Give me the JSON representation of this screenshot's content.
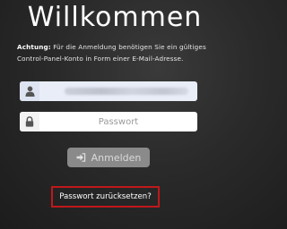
{
  "heading": "Willkommen",
  "notice": {
    "label": "Achtung:",
    "text": "Für die Anmeldung benötigen Sie ein gültiges Control-Panel-Konto in Form einer E-Mail-Adresse."
  },
  "form": {
    "username_icon": "user-icon",
    "password_icon": "lock-icon",
    "password_placeholder": "Passwort",
    "login_icon": "sign-in-icon",
    "login_label": "Anmelden",
    "reset_link": "Passwort zurücksetzen?"
  },
  "colors": {
    "background": "#2a2a2a",
    "highlight_border": "#c0181b",
    "button_disabled": "#8a8a8a"
  }
}
